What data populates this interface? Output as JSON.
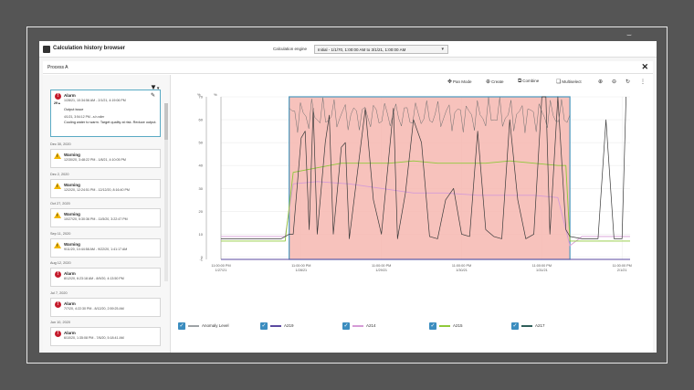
{
  "app": {
    "title": "Calculation history browser",
    "engine_label": "Calculation engine",
    "engine_value": "Initial - 1/1/70, 1:00:00 AM to 3/1/21, 1:00:00 AM"
  },
  "panel": {
    "title": "Process A",
    "close": "✕"
  },
  "sidebar": {
    "selected": {
      "type": "Alarm",
      "badge": "29 ▴",
      "range": "1/28/21, 10:34:56 AM - 2/1/21, 4:19:06 PM",
      "issue": "Output issue",
      "timestamp": "4/1/21, 3:54:12 PM - a.h.wiler",
      "note": "Cooling water to warm. Target quality at risk. Reduce output."
    },
    "groups": [
      {
        "date": "Dec 30, 2020",
        "type": "Warning",
        "kind": "warn",
        "range": "12/30/20, 3:48:22 PM - 1/8/21, 4:10:05 PM"
      },
      {
        "date": "Dec 2, 2020",
        "type": "Warning",
        "kind": "warn",
        "range": "12/2/20, 12:24:51 PM - 12/12/20, 8:16:40 PM"
      },
      {
        "date": "Oct 27, 2020",
        "type": "Warning",
        "kind": "warn",
        "range": "10/27/20, 5:30:36 PM - 11/5/20, 3:22:47 PM"
      },
      {
        "date": "Sep 11, 2020",
        "type": "Warning",
        "kind": "warn",
        "range": "9/11/20, 10:44:58 AM - 9/22/20, 1:41:17 AM"
      },
      {
        "date": "Aug 12, 2020",
        "type": "Alarm",
        "kind": "alarm",
        "range": "8/12/20, 6:23:18 AM - 8/9/20, 4:13:50 PM"
      },
      {
        "date": "Jul 7, 2020",
        "type": "Alarm",
        "kind": "alarm",
        "range": "7/7/20, 4:22:30 PM - 8/12/20, 2:59:25 AM"
      },
      {
        "date": "Jun 10, 2020",
        "type": "Alarm",
        "kind": "alarm",
        "range": "6/10/20, 1:35:08 PM - 7/6/20, 5:18:41 AM"
      }
    ]
  },
  "toolbar": {
    "pan_icon": "move-icon",
    "pan": "Pan Mode",
    "create_icon": "search-plus-icon",
    "create": "Create",
    "combine_icon": "combine-icon",
    "combine": "Combine",
    "multiselect_icon": "multiselect-icon",
    "multiselect": "Multiselect",
    "zoom_in_icon": "zoom-in-icon",
    "zoom_out_icon": "zoom-out-icon",
    "reset_icon": "refresh-icon",
    "more_icon": "more-vertical-icon"
  },
  "chart_data": {
    "type": "line",
    "y_axis_left_title": "%",
    "y_axis_right_title": "%",
    "y_ticks": [
      "70",
      "60",
      "50",
      "40",
      "30",
      "20",
      "10",
      "0",
      "-1"
    ],
    "x_ticks": [
      [
        "11:00:00 PM",
        "1/27/21"
      ],
      [
        "11:00:00 PM",
        "1/28/21"
      ],
      [
        "11:00:00 PM",
        "1/29/21"
      ],
      [
        "11:00:00 PM",
        "1/30/21"
      ],
      [
        "11:00:00 PM",
        "1/31/21"
      ],
      [
        "11:00:00 PM",
        "2/1/21"
      ]
    ],
    "ylim": [
      -1,
      70
    ],
    "highlight": {
      "from_x": 0.85,
      "to_x": 4.35,
      "color": "#f6b7b0",
      "border": "#4a98bd"
    },
    "series": [
      {
        "name": "Anomaly Level",
        "color": "#9ea3a6",
        "x": [
          0,
          0.85,
          0.85,
          4.35,
          4.35,
          5.1
        ],
        "y": [
          -1,
          -1,
          70,
          70,
          -1,
          -1
        ]
      },
      {
        "name": "A219",
        "color": "#5b4aa0",
        "x": [
          0,
          0.8,
          1.2,
          2,
          3,
          4.3,
          4.5,
          5.1
        ],
        "y": [
          -1,
          -1,
          -1,
          -1,
          -1,
          -1,
          -1,
          -1
        ]
      },
      {
        "name": "A214",
        "color": "#d59bd6",
        "x": [
          0,
          0.8,
          0.9,
          1.2,
          1.6,
          2,
          2.4,
          2.8,
          3.2,
          3.6,
          3.9,
          4.2,
          4.35,
          4.5,
          5.1
        ],
        "y": [
          9,
          9,
          32,
          33,
          32,
          30,
          28,
          28,
          27,
          27,
          27,
          26,
          5,
          9,
          9
        ]
      },
      {
        "name": "A215",
        "color": "#8fc93a",
        "x": [
          0,
          0.8,
          0.9,
          1.2,
          1.5,
          1.8,
          2.1,
          2.4,
          2.7,
          3,
          3.3,
          3.6,
          3.9,
          4.2,
          4.3,
          4.35,
          5.1
        ],
        "y": [
          7,
          7,
          37,
          39,
          41,
          41,
          41,
          42,
          41,
          41,
          41,
          42,
          41,
          40,
          40,
          7,
          7
        ]
      },
      {
        "name": "A217",
        "color": "#3a3a3a",
        "x": [
          0,
          0.75,
          0.85,
          0.9,
          1.0,
          1.05,
          1.1,
          1.15,
          1.2,
          1.3,
          1.35,
          1.4,
          1.5,
          1.55,
          1.6,
          1.8,
          1.9,
          2.0,
          2.15,
          2.2,
          2.3,
          2.4,
          2.5,
          2.6,
          2.7,
          2.8,
          2.9,
          3.0,
          3.1,
          3.2,
          3.3,
          3.4,
          3.5,
          3.6,
          3.7,
          3.8,
          3.9,
          4.0,
          4.05,
          4.1,
          4.2,
          4.3,
          4.35,
          4.5,
          4.7,
          4.8,
          4.9,
          5.0,
          5.05
        ],
        "y": [
          8,
          8,
          10,
          10,
          52,
          55,
          12,
          65,
          10,
          50,
          62,
          10,
          48,
          50,
          8,
          65,
          25,
          10,
          65,
          8,
          28,
          60,
          50,
          9,
          8,
          25,
          30,
          10,
          9,
          55,
          12,
          9,
          8,
          60,
          25,
          8,
          10,
          70,
          70,
          10,
          70,
          12,
          9,
          8,
          8,
          60,
          8,
          8,
          70
        ]
      }
    ]
  },
  "legend": {
    "check": "✓",
    "items": [
      "Anomaly Level",
      "A219",
      "A214",
      "A215",
      "A217"
    ],
    "colors": [
      "#9ea3a6",
      "#5b4aa0",
      "#d59bd6",
      "#8fc93a",
      "#2f5f5a"
    ]
  }
}
